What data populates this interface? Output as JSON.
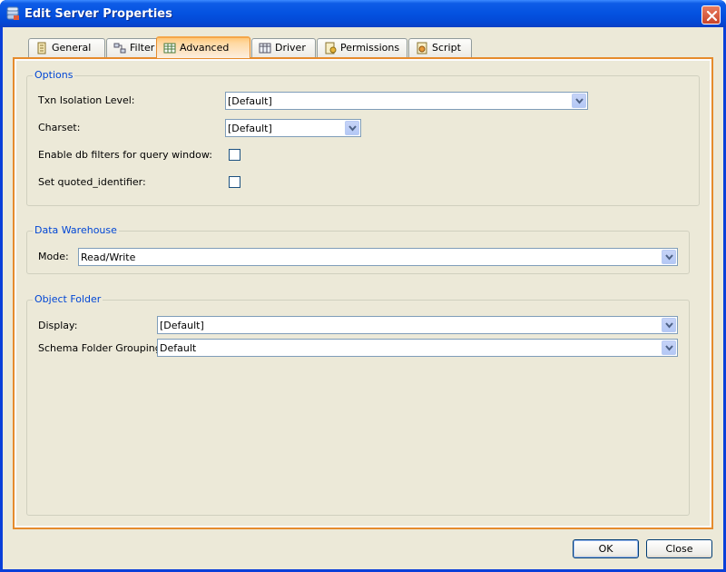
{
  "window": {
    "title": "Edit Server Properties",
    "icons": {
      "title": "server-icon",
      "close": "close-icon"
    }
  },
  "tabs": [
    {
      "label": "General",
      "icon": "general-icon",
      "active": false
    },
    {
      "label": "Filter",
      "icon": "filter-icon",
      "active": false
    },
    {
      "label": "Advanced",
      "icon": "advanced-icon",
      "active": true
    },
    {
      "label": "Driver",
      "icon": "driver-icon",
      "active": false
    },
    {
      "label": "Permissions",
      "icon": "permissions-icon",
      "active": false
    },
    {
      "label": "Script",
      "icon": "script-icon",
      "active": false
    }
  ],
  "options": {
    "title": "Options",
    "txn_label": "Txn Isolation Level:",
    "txn_value": "[Default]",
    "charset_label": "Charset:",
    "charset_value": "[Default]",
    "db_filters_label": "Enable db filters for query window:",
    "db_filters_checked": false,
    "quoted_label": "Set quoted_identifier:",
    "quoted_checked": false
  },
  "warehouse": {
    "title": "Data Warehouse",
    "mode_label": "Mode:",
    "mode_value": "Read/Write"
  },
  "object_folder": {
    "title": "Object Folder",
    "display_label": "Display:",
    "display_value": "[Default]",
    "grouping_label": "Schema Folder Grouping:",
    "grouping_value": "Default"
  },
  "buttons": {
    "ok": "OK",
    "close": "Close"
  },
  "colors": {
    "accent": "#e68b2c",
    "title_bar": "#0553e1",
    "group_title": "#0046d5"
  }
}
